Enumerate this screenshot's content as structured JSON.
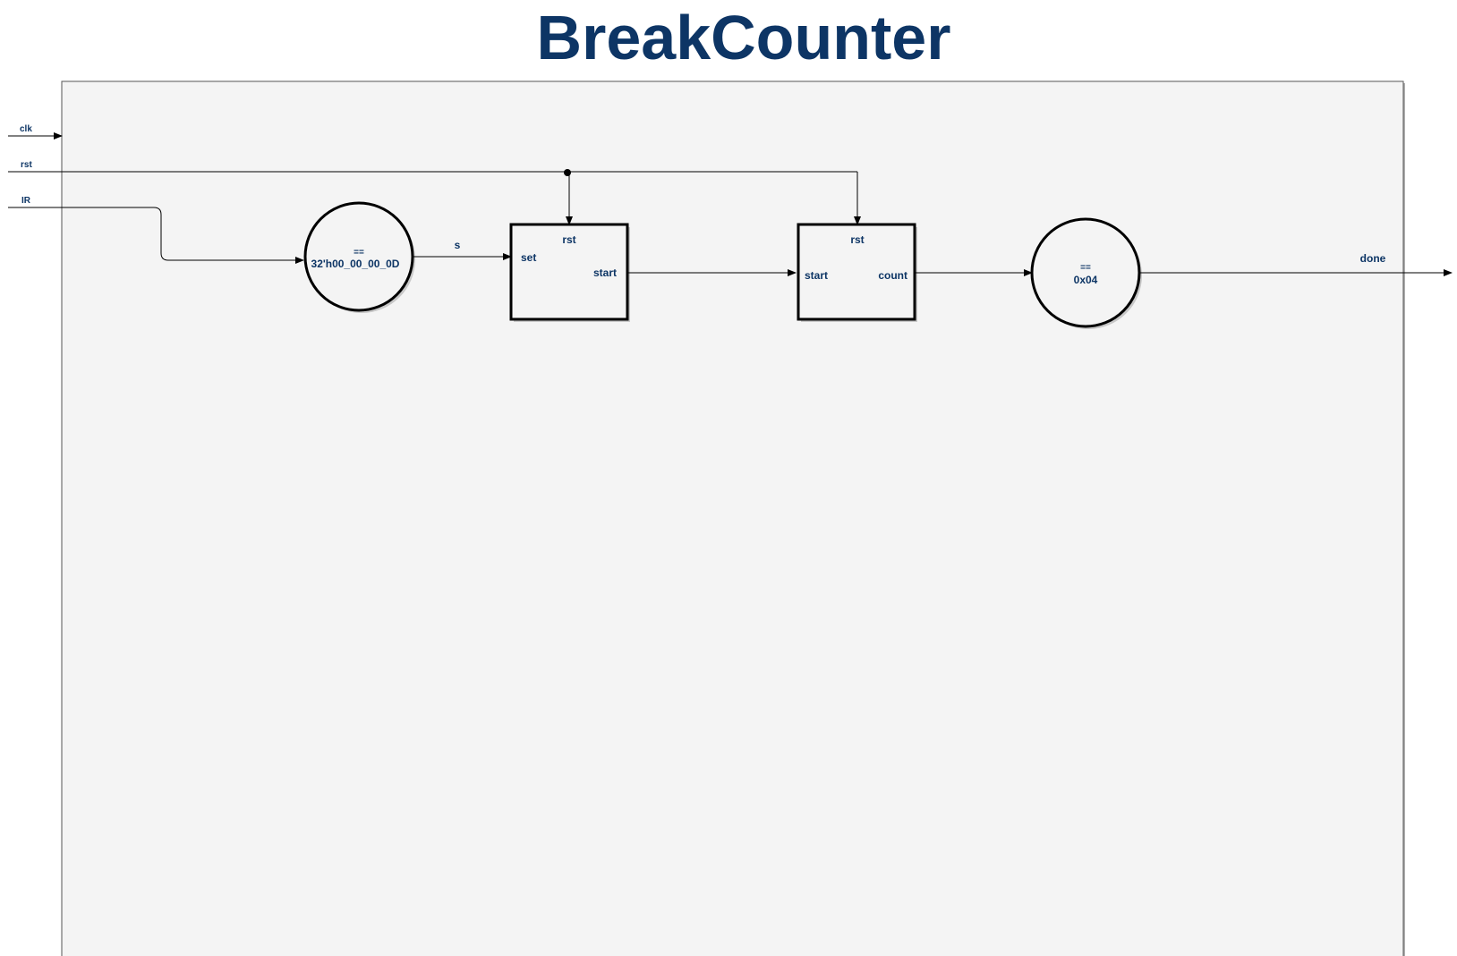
{
  "title": "BreakCounter",
  "inputs": {
    "clk": "clk",
    "rst": "rst",
    "ir": "IR"
  },
  "output": {
    "done": "done"
  },
  "wires": {
    "s": "s"
  },
  "comparator1": {
    "op": "==",
    "value": "32'h00_00_00_0D"
  },
  "latch": {
    "rst": "rst",
    "set": "set",
    "start": "start"
  },
  "counter": {
    "rst": "rst",
    "start": "start",
    "count": "count"
  },
  "comparator2": {
    "op": "==",
    "value": "0x04"
  },
  "colors": {
    "text": "#0d3565",
    "module_fill": "#f4f4f4",
    "wire": "#000000"
  }
}
